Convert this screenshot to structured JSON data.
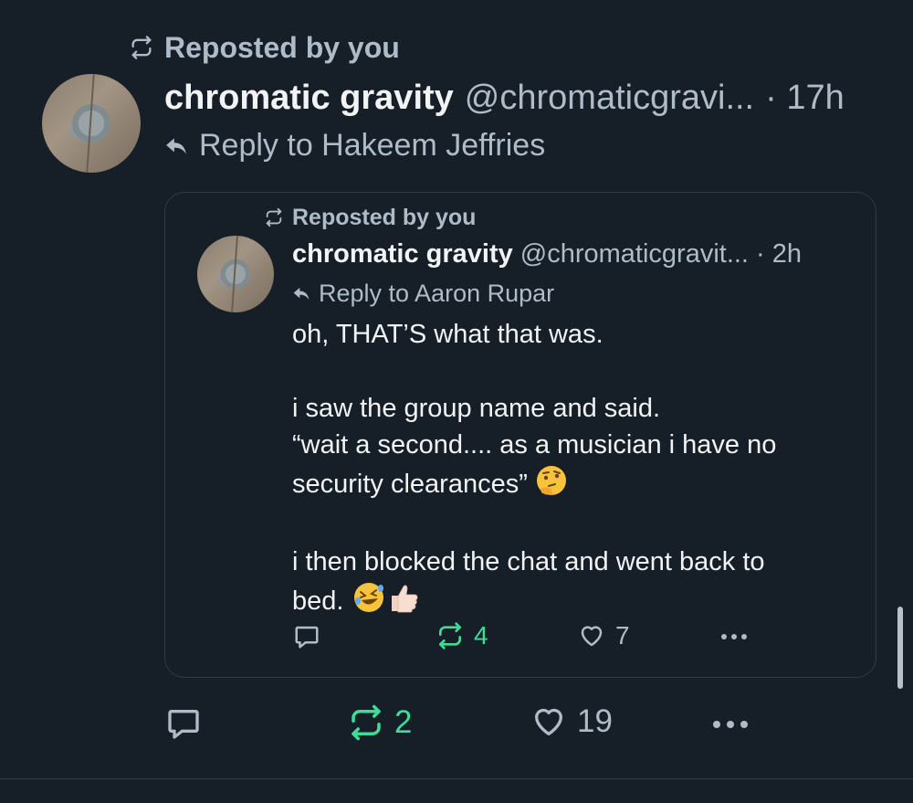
{
  "outer_post": {
    "repost_label": "Reposted by you",
    "author_name": "chromatic gravity",
    "author_handle": "@chromaticgravi...",
    "time": "· 17h",
    "reply_to": "Reply to Hakeem Jeffries",
    "avatar_icon": "rock-avatar",
    "actions": {
      "reply_count": "",
      "repost_count": "2",
      "like_count": "19"
    }
  },
  "quoted_post": {
    "repost_label": "Reposted by you",
    "author_name": "chromatic gravity",
    "author_handle": "@chromaticgravit...",
    "time": "· 2h",
    "reply_to": "Reply to Aaron Rupar",
    "avatar_icon": "rock-avatar",
    "body": {
      "line1": "oh, THAT’S what that was.",
      "line2": "i saw the group name and said.",
      "line3": "“wait a second.... as a musician i have no",
      "line4": "security clearances”",
      "line5": "i then blocked the chat and went back to",
      "line6": "bed."
    },
    "emojis": {
      "thinking": "thinking-face-emoji",
      "rofl": "rolling-on-floor-laughing-emoji",
      "thumbs_up": "thumbs-up-emoji"
    },
    "actions": {
      "repost_count": "4",
      "like_count": "7"
    }
  },
  "colors": {
    "background": "#161e27",
    "text_primary": "#f1f3f5",
    "text_secondary": "#aebbc9",
    "repost_green": "#3ddc97",
    "border": "#2e3a48"
  }
}
